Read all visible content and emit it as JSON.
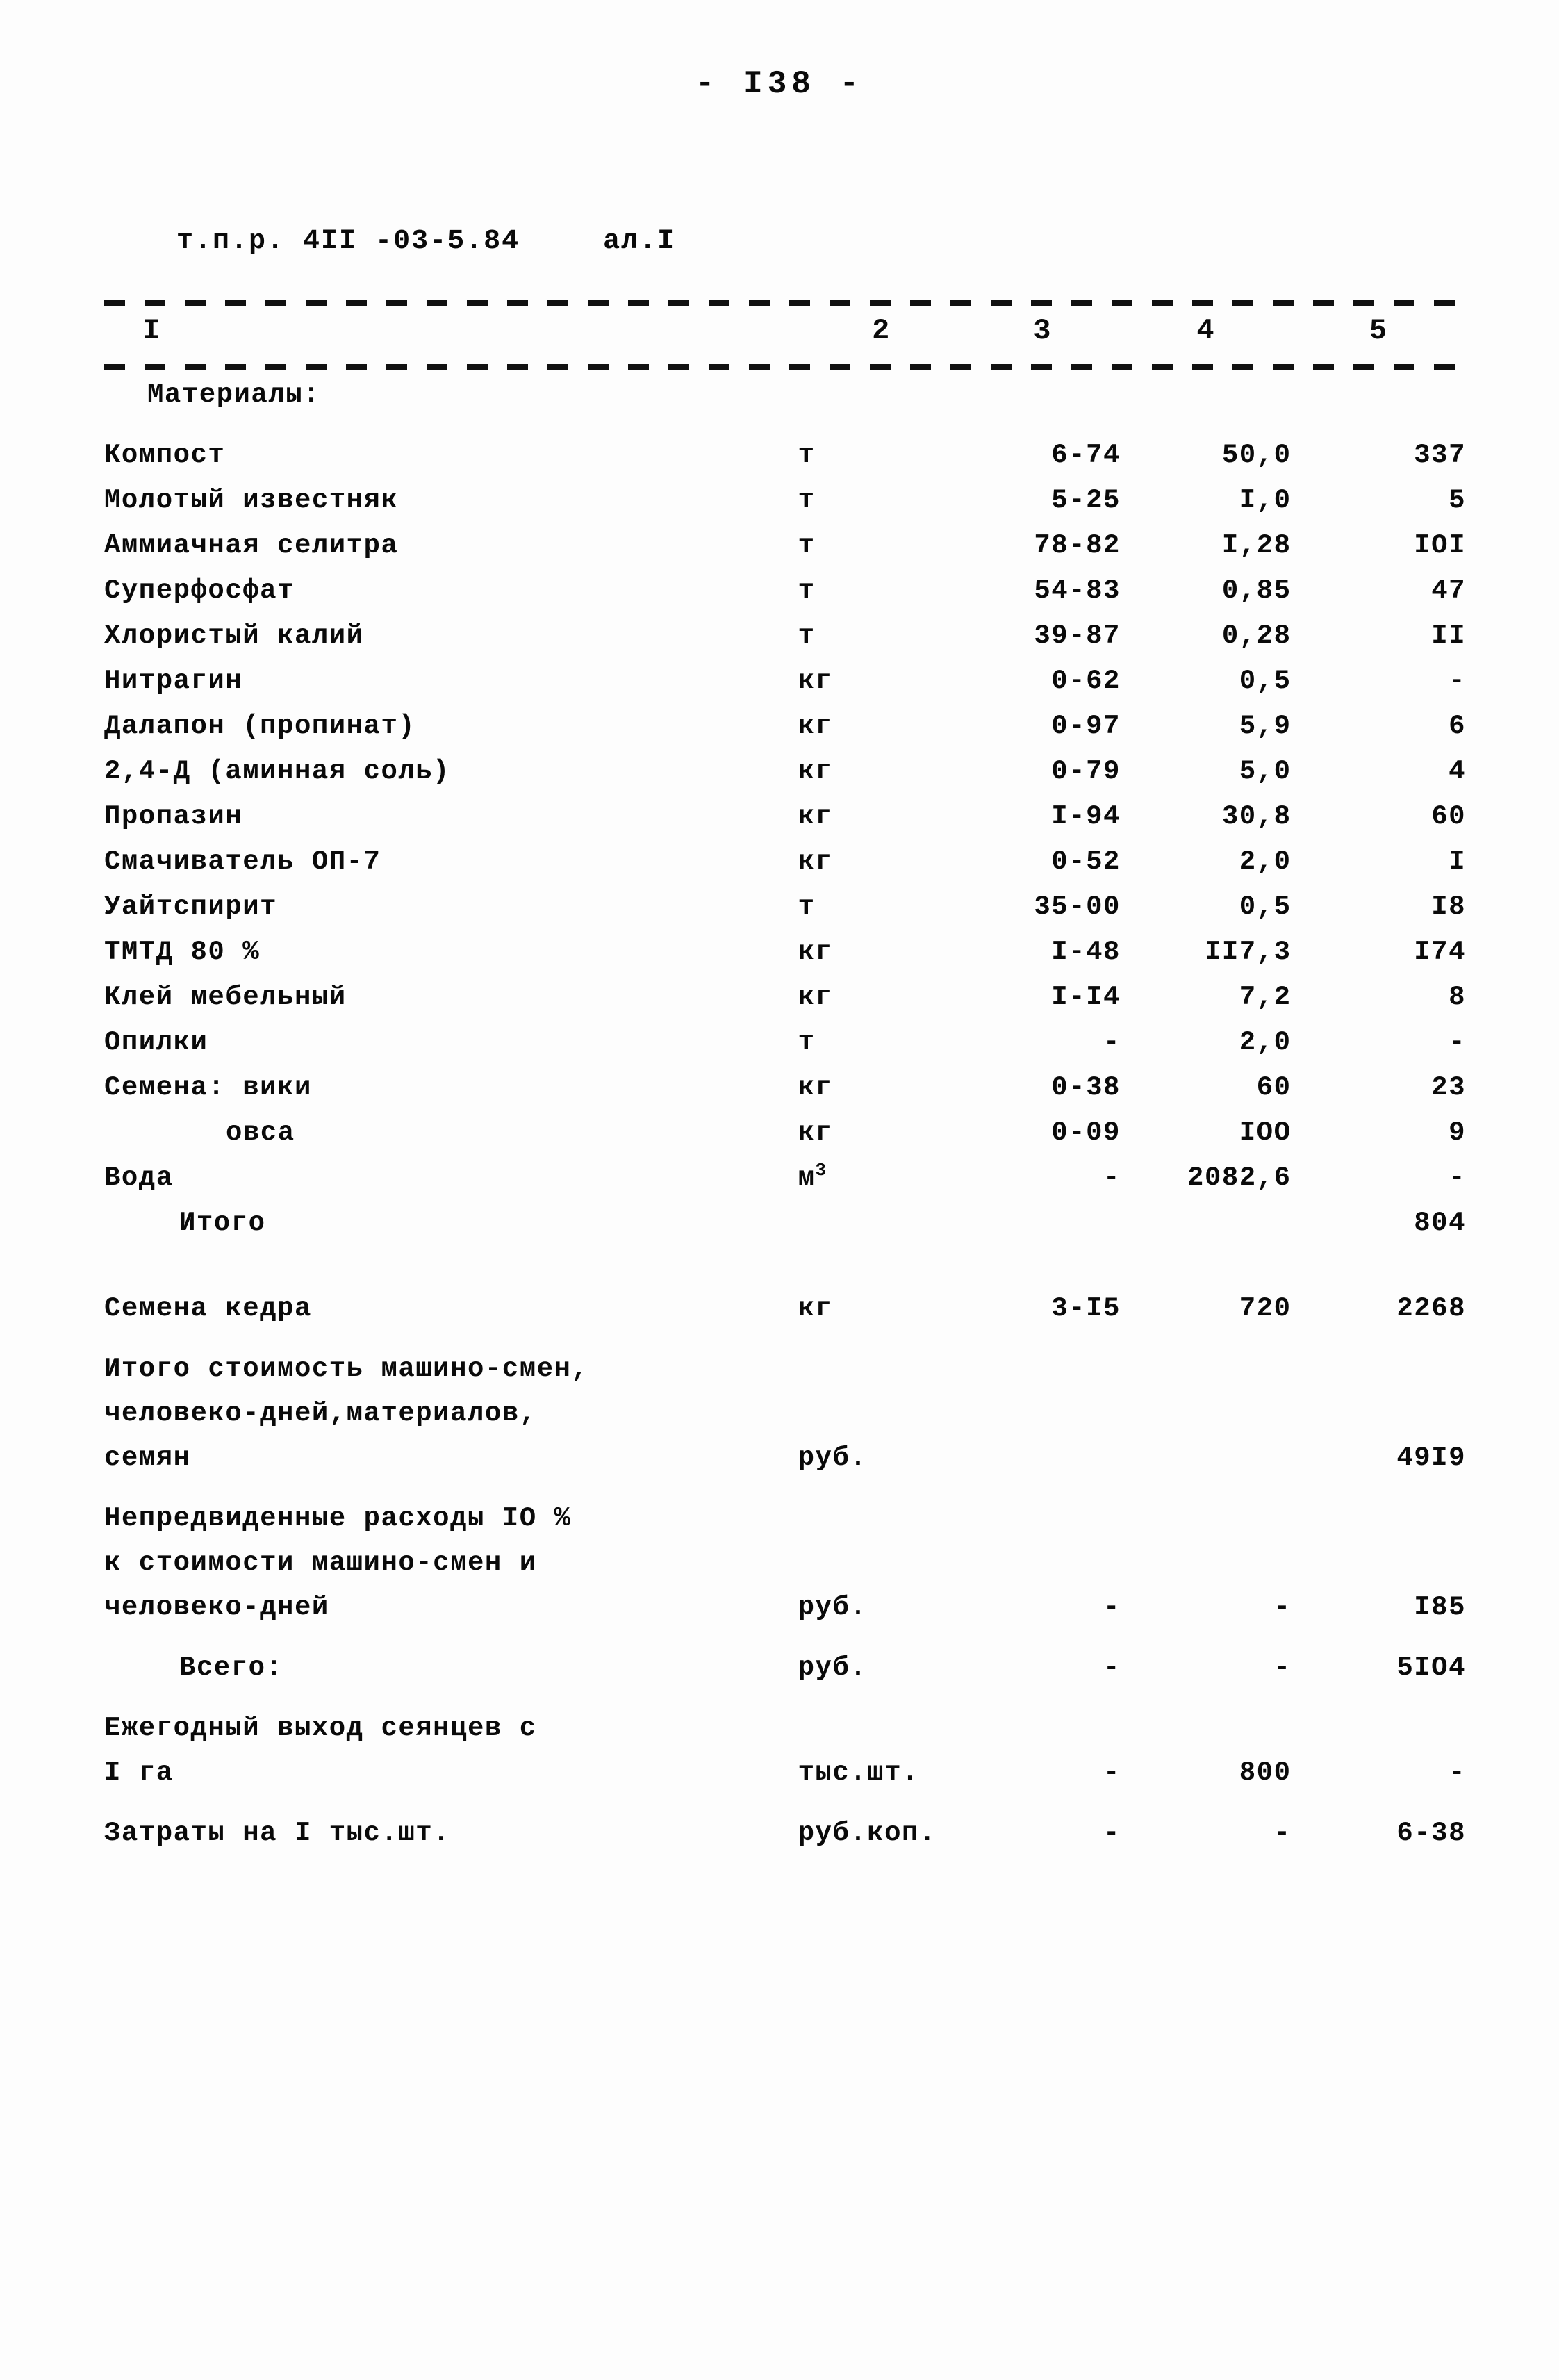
{
  "page": {
    "number": "- I38 -",
    "doc_code": "т.п.р. 4II -03-5.84",
    "sheet": "ал.I"
  },
  "table": {
    "column_numbers": [
      "I",
      "2",
      "3",
      "4",
      "5"
    ],
    "section_title": "Материалы:",
    "materials": [
      {
        "name": "Компост",
        "unit": "т",
        "c3": "6-74",
        "c4": "50,0",
        "c5": "337"
      },
      {
        "name": "Молотый известняк",
        "unit": "т",
        "c3": "5-25",
        "c4": "I,0",
        "c5": "5"
      },
      {
        "name": "Аммиачная селитра",
        "unit": "т",
        "c3": "78-82",
        "c4": "I,28",
        "c5": "IOI"
      },
      {
        "name": "Суперфосфат",
        "unit": "т",
        "c3": "54-83",
        "c4": "0,85",
        "c5": "47"
      },
      {
        "name": "Хлористый калий",
        "unit": "т",
        "c3": "39-87",
        "c4": "0,28",
        "c5": "II"
      },
      {
        "name": "Нитрагин",
        "unit": "кг",
        "c3": "0-62",
        "c4": "0,5",
        "c5": "-"
      },
      {
        "name": "Далапон (пропинат)",
        "unit": "кг",
        "c3": "0-97",
        "c4": "5,9",
        "c5": "6"
      },
      {
        "name": "2,4-Д (аминная соль)",
        "unit": "кг",
        "c3": "0-79",
        "c4": "5,0",
        "c5": "4"
      },
      {
        "name": "Пропазин",
        "unit": "кг",
        "c3": "I-94",
        "c4": "30,8",
        "c5": "60"
      },
      {
        "name": "Смачиватель ОП-7",
        "unit": "кг",
        "c3": "0-52",
        "c4": "2,0",
        "c5": "I"
      },
      {
        "name": "Уайтспирит",
        "unit": "т",
        "c3": "35-00",
        "c4": "0,5",
        "c5": "I8"
      },
      {
        "name": "ТМТД 80 %",
        "unit": "кг",
        "c3": "I-48",
        "c4": "II7,3",
        "c5": "I74"
      },
      {
        "name": "Клей мебельный",
        "unit": "кг",
        "c3": "I-I4",
        "c4": "7,2",
        "c5": "8"
      },
      {
        "name": "Опилки",
        "unit": "т",
        "c3": "-",
        "c4": "2,0",
        "c5": "-"
      },
      {
        "name": "Семена: вики",
        "unit": "кг",
        "c3": "0-38",
        "c4": "60",
        "c5": "23"
      },
      {
        "name": "овса",
        "unit": "кг",
        "c3": "0-09",
        "c4": "IOO",
        "c5": "9"
      }
    ],
    "water": {
      "name": "Вода",
      "unit_base": "м",
      "unit_sup": "3",
      "c3": "-",
      "c4": "2082,6",
      "c5": "-"
    },
    "subtotal": {
      "name": "Итого",
      "unit": "",
      "c3": "",
      "c4": "",
      "c5": "804"
    },
    "cedar_seeds": {
      "name": "Семена кедра",
      "unit": "кг",
      "c3": "3-I5",
      "c4": "720",
      "c5": "2268"
    },
    "total_cost": {
      "line1": "Итого стоимость машино-смен,",
      "line2": "человеко-дней,материалов,",
      "line3": "семян",
      "unit": "руб.",
      "c3": "",
      "c4": "",
      "c5": "49I9"
    },
    "contingency": {
      "line1": "Непредвиденные расходы IO %",
      "line2": "к стоимости машино-смен и",
      "line3": "человеко-дней",
      "unit": "руб.",
      "c3": "-",
      "c4": "-",
      "c5": "I85"
    },
    "grand_total": {
      "name": "Всего:",
      "unit": "руб.",
      "c3": "-",
      "c4": "-",
      "c5": "5IO4"
    },
    "annual_yield": {
      "line1": "Ежегодный выход сеянцев с",
      "line2": "I га",
      "unit": "тыс.шт.",
      "c3": "-",
      "c4": "800",
      "c5": "-"
    },
    "cost_per_thousand": {
      "name": "Затраты на I тыс.шт.",
      "unit": "руб.коп.",
      "c3": "-",
      "c4": "-",
      "c5": "6-38"
    }
  }
}
